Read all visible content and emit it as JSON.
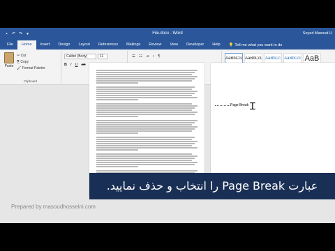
{
  "titlebar": {
    "document_title": "File.docx - Word",
    "user": "Seyed Masoud H"
  },
  "tabs": [
    "File",
    "Home",
    "Insert",
    "Design",
    "Layout",
    "References",
    "Mailings",
    "Review",
    "View",
    "Developer",
    "Help"
  ],
  "active_tab": "Home",
  "tell_me": "Tell me what you want to do",
  "ribbon": {
    "clipboard": {
      "paste_label": "Paste",
      "cut": "Cut",
      "copy": "Copy",
      "format_painter": "Format Painter",
      "group_label": "Clipboard"
    },
    "font": {
      "font_name": "Calibri (Body)",
      "font_size": "11",
      "group_label": "Font"
    },
    "paragraph": {
      "group_label": "Paragraph"
    },
    "styles": {
      "items": [
        {
          "sample": "AaBbCcDc",
          "name": "¶ Normal"
        },
        {
          "sample": "AaBbCcDc",
          "name": "¶ No Spac..."
        },
        {
          "sample": "AaBbCc",
          "name": "Heading 1"
        },
        {
          "sample": "AaBbCcI",
          "name": "Heading 2"
        },
        {
          "sample": "AaB",
          "name": "Title"
        }
      ],
      "group_label": "Styles"
    }
  },
  "page2": {
    "page_break_label": "Page Break"
  },
  "caption": "عبارت Page Break را انتخاب و حذف نمایید.",
  "credit": "Prepared by masoudhosseini.com"
}
